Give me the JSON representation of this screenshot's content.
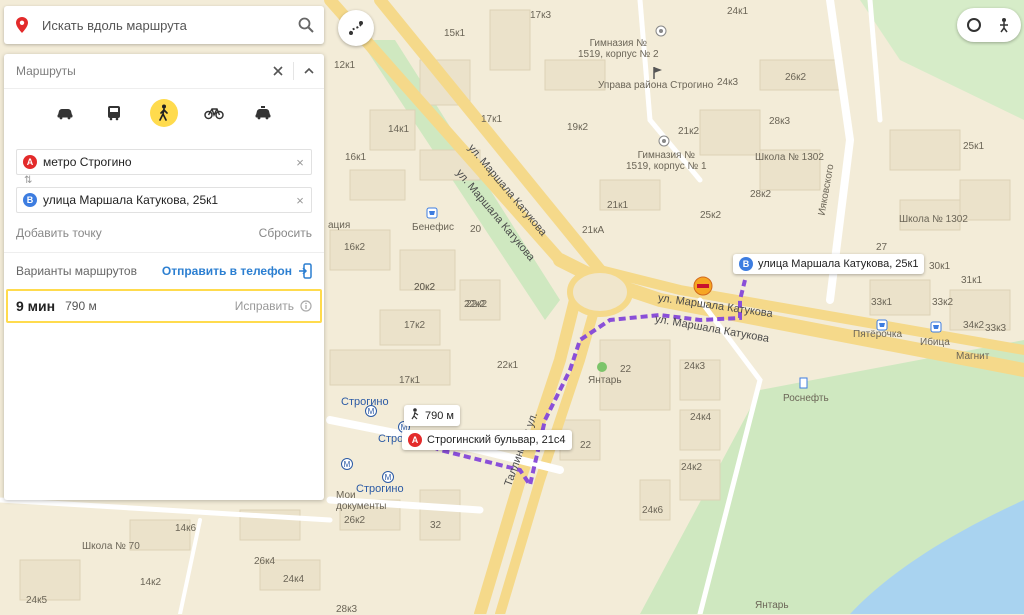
{
  "search": {
    "placeholder": "Искать вдоль маршрута"
  },
  "panel": {
    "title": "Маршруты",
    "point_a": {
      "badge": "A",
      "value": "метро Строгино"
    },
    "point_b": {
      "badge": "B",
      "value": "улица Маршала Катукова, 25к1"
    },
    "add_point": "Добавить точку",
    "reset": "Сбросить",
    "variants_label": "Варианты маршрутов",
    "send_to_phone": "Отправить в телефон",
    "route": {
      "time": "9 мин",
      "distance": "790 м",
      "fix": "Исправить"
    }
  },
  "modes": [
    "car-icon",
    "bus-icon",
    "walk-icon",
    "bike-icon",
    "taxi-icon"
  ],
  "map": {
    "dest_callout": {
      "badge": "B",
      "text": "улица Маршала Катукова, 25к1"
    },
    "start_callout": {
      "badge": "A",
      "text": "Строгинский бульвар, 21с4"
    },
    "distance_callout": "790 м",
    "streets": [
      "ул. Маршала Катукова",
      "ул. Маршала Катукова",
      "ул. Маршала Катукова",
      "ул. Маршала Катукова",
      "Таллинская ул."
    ],
    "places": {
      "gym1519_2": "Гимназия №\n1519, корпус № 2",
      "gym1519_1": "Гимназия №\n1519, корпус № 1",
      "uprava": "Управа района Строгино",
      "school1302_a": "Школа № 1302",
      "school1302_b": "Школа № 1302",
      "school70": "Школа № 70",
      "benefis": "Бенефис",
      "yantar": "Янтарь",
      "pyaterochka": "Пятёрочка",
      "ibitsa": "Ибица",
      "magnit": "Магнит",
      "rosneft": "Роснефть",
      "metro_strogino": "Строгино",
      "metro_strogino2": "Строгино",
      "metro_strogino3": "Строг",
      "moi_dokumenty": "Мои\nдокументы",
      "yantar_bottom": "Янтарь",
      "akovskogo": "Ияковского",
      "atsiya": "ация"
    },
    "buildings": [
      "17к3",
      "15к1",
      "24к1",
      "12к1",
      "24к3",
      "26к2",
      "14к1",
      "17к1",
      "19к2",
      "21к2",
      "28к3",
      "25к1",
      "16к2",
      "20к2",
      "22к2",
      "16к1",
      "21кА",
      "25к2",
      "21к1",
      "28к2",
      "33к1",
      "30к1",
      "27",
      "31к1",
      "34к2",
      "33к2",
      "33к3",
      "20к2",
      "22к2",
      "17к2",
      "22к1",
      "17к1",
      "24к3",
      "24к4",
      "24к2",
      "24к6",
      "26к2",
      "26к4",
      "24к4",
      "14к6",
      "14к2",
      "24к5",
      "28к3",
      "22",
      "20",
      "32",
      "22"
    ]
  },
  "colors": {
    "route": "#8a4fd8",
    "accent": "#ffdb4d",
    "link": "#2c7fd1",
    "badge_a": "#e32b2b",
    "badge_b": "#3d7de0",
    "park": "#cfe8c0",
    "water": "#a9d3f0"
  }
}
